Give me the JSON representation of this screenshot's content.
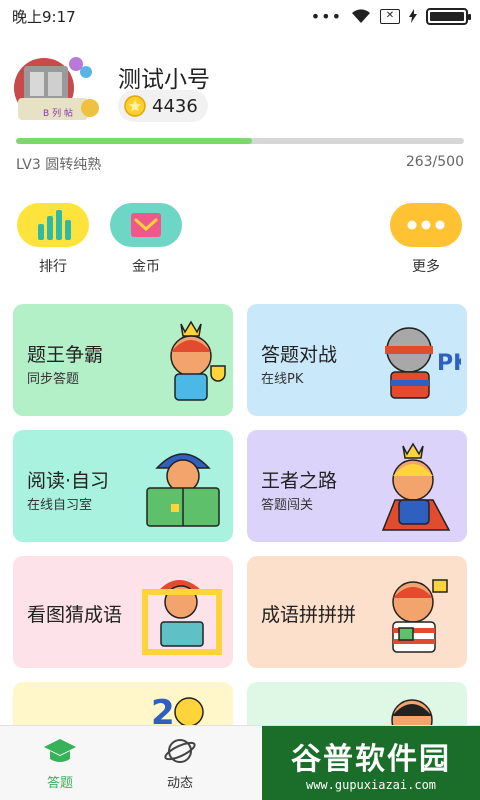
{
  "status_bar": {
    "time": "晚上9:17",
    "dots": "•••"
  },
  "profile": {
    "username": "测试小号",
    "coins": "4436",
    "level": "LV3 圆转纯熟",
    "progress_text": "263/500",
    "progress_fraction": 0.526
  },
  "quick_actions": [
    {
      "label": "排行",
      "icon": "bar-chart-icon",
      "color": "#ffe33d"
    },
    {
      "label": "金币",
      "icon": "mail-envelope-icon",
      "color": "#6ed6c4"
    },
    {
      "label": "更多",
      "icon": "more-dots-icon",
      "color": "#ffc233"
    }
  ],
  "cards": [
    {
      "title": "题王争霸",
      "subtitle": "同步答题",
      "color": "#b3efc7"
    },
    {
      "title": "答题对战",
      "subtitle": "在线PK",
      "color": "#c9e9fb"
    },
    {
      "title": "阅读·自习",
      "subtitle": "在线自习室",
      "color": "#a9f2df"
    },
    {
      "title": "王者之路",
      "subtitle": "答题闯关",
      "color": "#dcd3fb"
    },
    {
      "title": "看图猜成语",
      "subtitle": "",
      "color": "#fde2ea"
    },
    {
      "title": "成语拼拼拼",
      "subtitle": "",
      "color": "#fde0cc"
    },
    {
      "title": "",
      "subtitle": "",
      "color": "#fff6c9"
    },
    {
      "title": "",
      "subtitle": "",
      "color": "#dff8e6"
    }
  ],
  "tabs": [
    {
      "label": "答题",
      "icon": "graduation-cap-icon",
      "active": true
    },
    {
      "label": "动态",
      "icon": "planet-icon",
      "active": false
    }
  ],
  "watermark": {
    "main": "谷普软件园",
    "url": "www.gupuxiazai.com"
  }
}
